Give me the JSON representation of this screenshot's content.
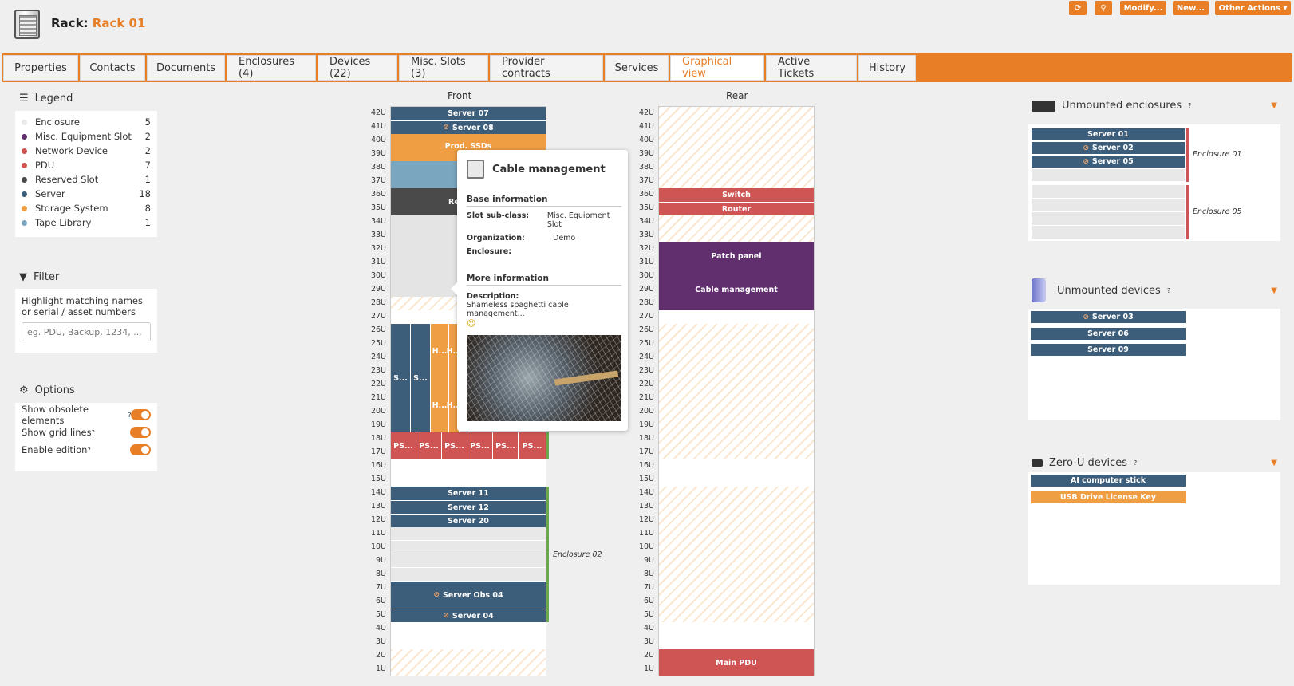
{
  "header": {
    "rack_label": "Rack:",
    "rack_name": "Rack 01"
  },
  "toolbar": {
    "refresh_icon": "refresh-icon",
    "search_icon": "search-icon",
    "modify": "Modify...",
    "new": "New...",
    "other": "Other Actions"
  },
  "tabs": [
    "Properties",
    "Contacts",
    "Documents",
    "Enclosures (4)",
    "Devices (22)",
    "Misc. Slots (3)",
    "Provider contracts",
    "Services",
    "Graphical view",
    "Active Tickets",
    "History"
  ],
  "legend": {
    "title": "Legend",
    "items": [
      {
        "label": "Enclosure",
        "count": "5",
        "color": "#e9e9e9"
      },
      {
        "label": "Misc. Equipment Slot",
        "count": "2",
        "color": "#612e6e"
      },
      {
        "label": "Network Device",
        "count": "2",
        "color": "#cf5555"
      },
      {
        "label": "PDU",
        "count": "7",
        "color": "#cf5555"
      },
      {
        "label": "Reserved Slot",
        "count": "1",
        "color": "#4a4a4a"
      },
      {
        "label": "Server",
        "count": "18",
        "color": "#3d5e7a"
      },
      {
        "label": "Storage System",
        "count": "8",
        "color": "#ef9e44"
      },
      {
        "label": "Tape Library",
        "count": "1",
        "color": "#7ba6c0"
      }
    ]
  },
  "filter": {
    "title": "Filter",
    "hint": "Highlight matching names or serial / asset numbers",
    "placeholder": "eg. PDU, Backup, 1234, ..."
  },
  "options": {
    "title": "Options",
    "items": [
      "Show obsolete elements",
      "Show grid lines",
      "Enable edition"
    ]
  },
  "front": {
    "title": "Front",
    "slots": {
      "s07": "Server 07",
      "s08": "Server 08",
      "prod": "Prod. SSDs",
      "reserved": "Reserved",
      "s_a": "S...",
      "s_b": "S...",
      "h1": "H...",
      "h2": "H...",
      "h3": "H...",
      "h4": "H...",
      "ps": [
        "PS...",
        "PS...",
        "PS...",
        "PS...",
        "PS...",
        "PS..."
      ],
      "s11": "Server 11",
      "s12": "Server 12",
      "s20": "Server 20",
      "sobs04": "Server Obs 04",
      "s04": "Server 04",
      "enc02": "Enclosure 02"
    }
  },
  "rear": {
    "title": "Rear",
    "slots": {
      "switch": "Switch",
      "router": "Router",
      "patch": "Patch panel",
      "cable": "Cable management",
      "pdu": "Main PDU"
    }
  },
  "units": [
    "42U",
    "41U",
    "40U",
    "39U",
    "38U",
    "37U",
    "36U",
    "35U",
    "34U",
    "33U",
    "32U",
    "31U",
    "30U",
    "29U",
    "28U",
    "27U",
    "26U",
    "25U",
    "24U",
    "23U",
    "22U",
    "21U",
    "20U",
    "19U",
    "18U",
    "17U",
    "16U",
    "15U",
    "14U",
    "13U",
    "12U",
    "11U",
    "10U",
    "9U",
    "8U",
    "7U",
    "6U",
    "5U",
    "4U",
    "3U",
    "2U",
    "1U"
  ],
  "popup": {
    "title": "Cable management",
    "base": "Base information",
    "rows": [
      {
        "k": "Slot sub-class:",
        "v": "Misc. Equipment Slot"
      },
      {
        "k": "Organization:",
        "v": "Demo"
      },
      {
        "k": "Enclosure:",
        "v": ""
      }
    ],
    "more": "More information",
    "desc_k": "Description:",
    "desc_v": "Shameless spaghetti cable management...",
    "emoji": "☺"
  },
  "unmounted_enclosures": {
    "title": "Unmounted enclosures",
    "help": "?",
    "enc01": {
      "name": "Enclosure 01",
      "items": [
        "Server 01",
        "Server 02",
        "Server 05"
      ]
    },
    "enc05": {
      "name": "Enclosure 05"
    }
  },
  "unmounted_devices": {
    "title": "Unmounted devices",
    "help": "?",
    "items": [
      "Server 03",
      "Server 06",
      "Server 09"
    ]
  },
  "zerou": {
    "title": "Zero-U devices",
    "help": "?",
    "items": [
      "AI computer stick",
      "USB Drive License Key"
    ]
  },
  "colors": {
    "accent": "#e87e26",
    "server": "#3d5e7a",
    "storage": "#ef9e44",
    "network": "#cf5555",
    "misc": "#612e6e"
  }
}
